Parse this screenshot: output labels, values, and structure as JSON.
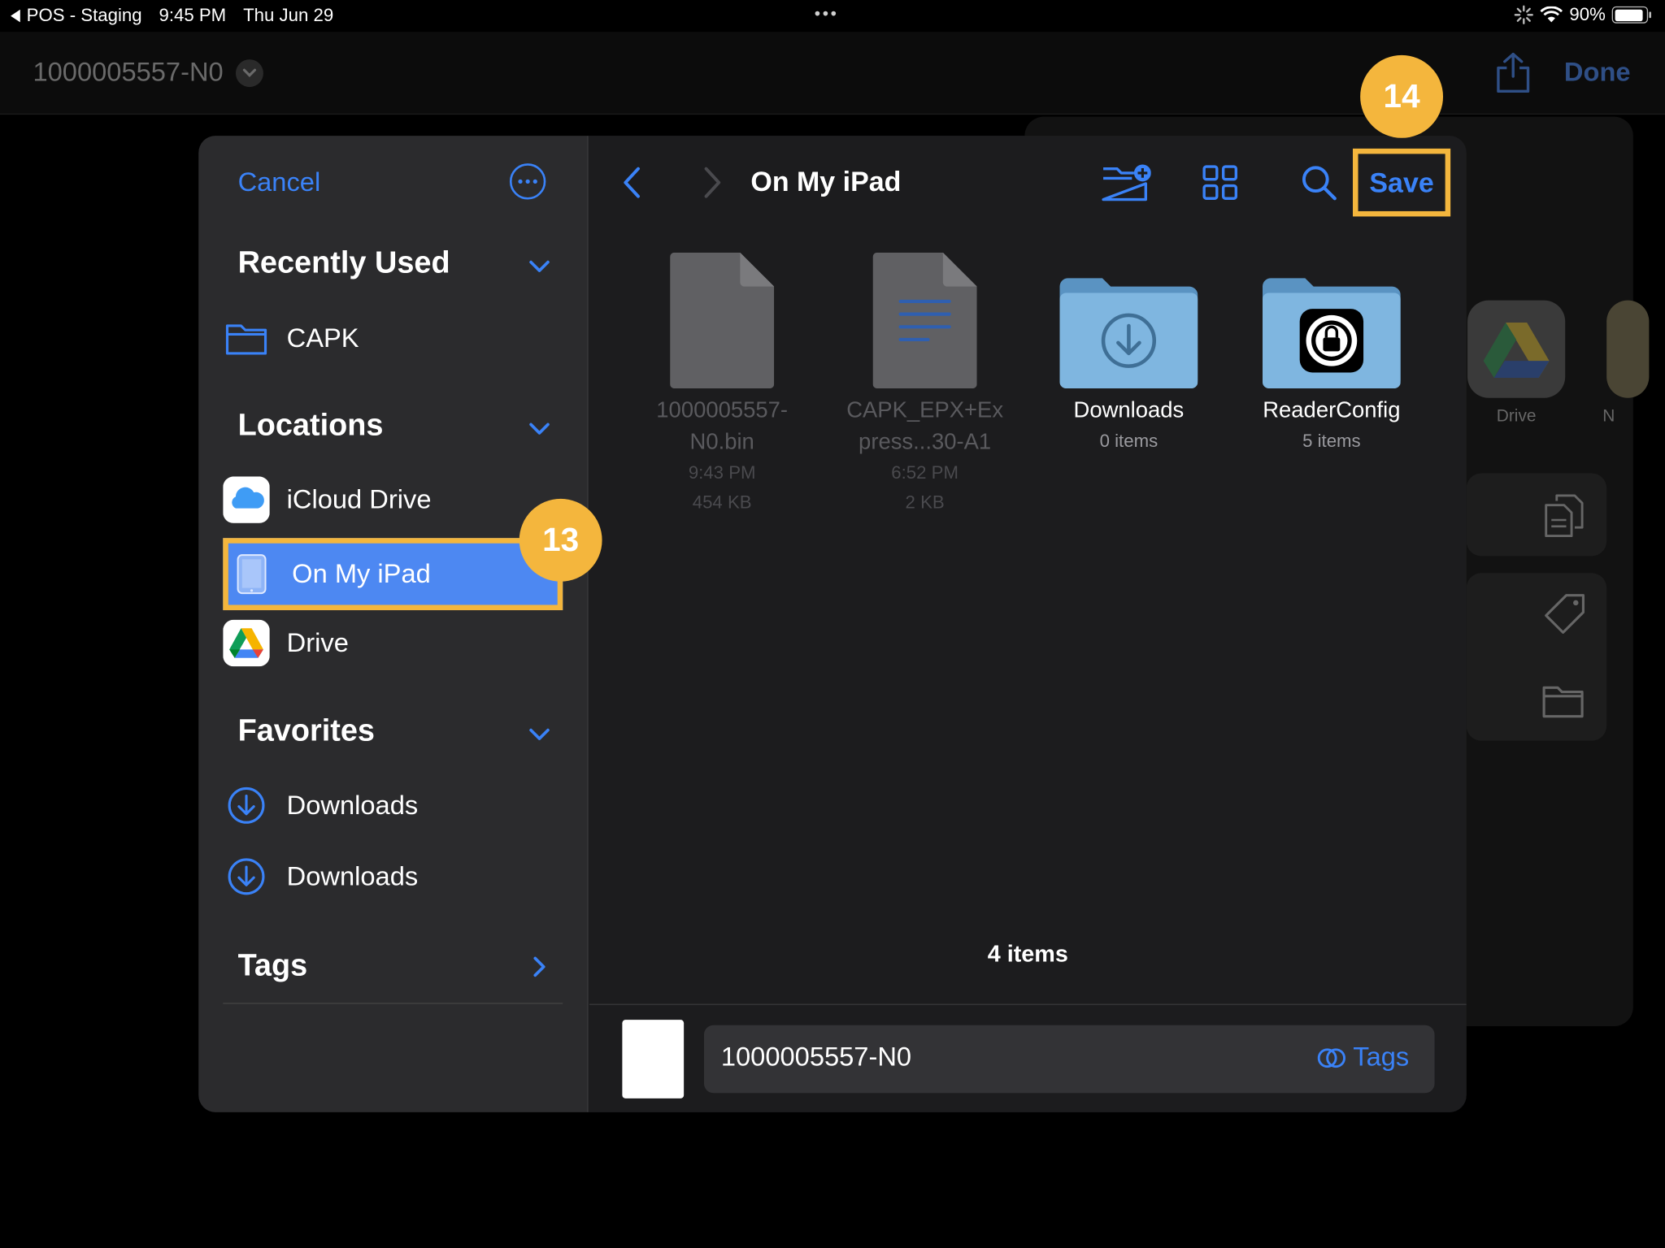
{
  "status_bar": {
    "back_app": "POS - Staging",
    "time": "9:45 PM",
    "date": "Thu Jun 29",
    "dots": "•••",
    "battery": "90%",
    "battery_level": 0.9
  },
  "background_app": {
    "document_title": "1000005557-N0",
    "done_label": "Done",
    "share_tiles": [
      {
        "label": "Drive",
        "icon": "google-drive-icon"
      },
      {
        "label": "N",
        "icon": "notes-icon"
      }
    ]
  },
  "picker": {
    "cancel_label": "Cancel",
    "sidebar": {
      "recently_used": {
        "title": "Recently Used",
        "items": [
          {
            "label": "CAPK",
            "icon": "folder-icon"
          }
        ]
      },
      "locations": {
        "title": "Locations",
        "items": [
          {
            "label": "iCloud Drive",
            "icon": "icloud-icon"
          },
          {
            "label": "On My iPad",
            "icon": "ipad-icon",
            "selected": true
          },
          {
            "label": "Drive",
            "icon": "google-drive-icon"
          }
        ]
      },
      "favorites": {
        "title": "Favorites",
        "items": [
          {
            "label": "Downloads",
            "icon": "download-circle-icon"
          },
          {
            "label": "Downloads",
            "icon": "download-circle-icon"
          }
        ]
      },
      "tags": {
        "title": "Tags"
      }
    },
    "toolbar": {
      "location_title": "On My iPad",
      "save_label": "Save"
    },
    "files": [
      {
        "name_line1": "1000005557-",
        "name_line2": "N0.bin",
        "meta1": "9:43 PM",
        "meta2": "454 KB",
        "type": "file",
        "dimmed": true
      },
      {
        "name_line1": "CAPK_EPX+Ex",
        "name_line2": "press...30-A1",
        "meta1": "6:52 PM",
        "meta2": "2 KB",
        "type": "document",
        "dimmed": true
      },
      {
        "name_line1": "Downloads",
        "meta1": "0 items",
        "type": "downloads-folder",
        "dimmed": false
      },
      {
        "name_line1": "ReaderConfig",
        "meta1": "5 items",
        "type": "app-folder",
        "dimmed": false
      }
    ],
    "item_count": "4 items",
    "filename_value": "1000005557-N0",
    "tags_label": "Tags"
  },
  "annotations": {
    "step_13": "13",
    "step_14": "14"
  },
  "colors": {
    "accent": "#3a82f7",
    "highlight": "#f4b63d",
    "selection": "#4d88f2"
  }
}
